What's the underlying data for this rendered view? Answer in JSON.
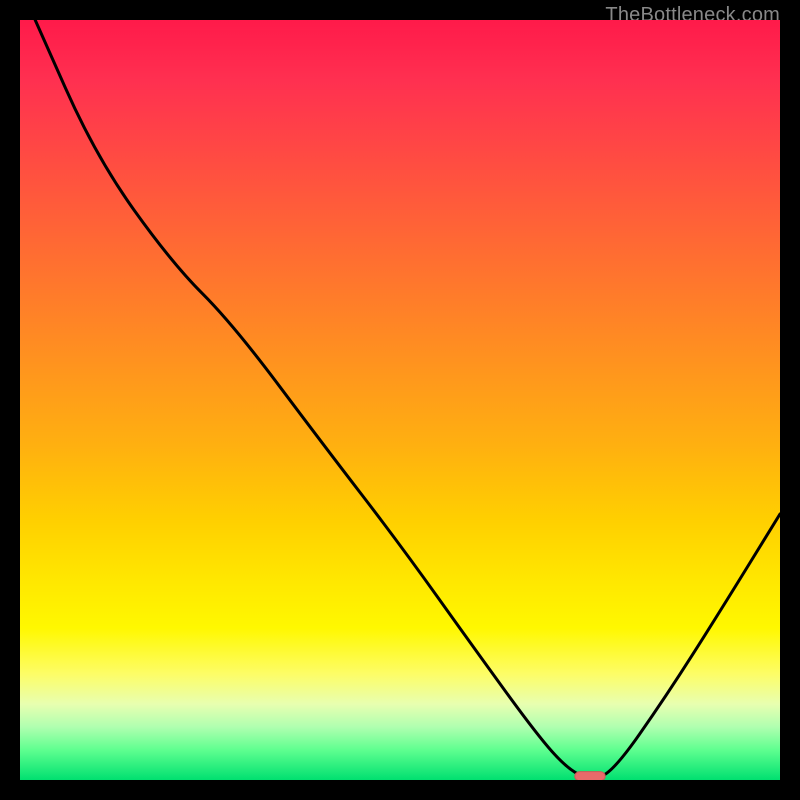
{
  "watermark": "TheBottleneck.com",
  "colors": {
    "background": "#000000",
    "curve": "#000000",
    "marker_fill": "#e86a6a",
    "marker_stroke": "#d05858"
  },
  "chart_data": {
    "type": "line",
    "title": "",
    "xlabel": "",
    "ylabel": "",
    "xlim": [
      0,
      100
    ],
    "ylim": [
      0,
      100
    ],
    "x": [
      2,
      10,
      20,
      28,
      40,
      50,
      60,
      68,
      72,
      75,
      78,
      85,
      92,
      100
    ],
    "values": [
      100,
      82,
      68,
      60,
      44,
      31,
      17,
      6,
      1.5,
      0,
      1,
      11,
      22,
      35
    ],
    "marker": {
      "x": 75,
      "y": 0.5,
      "width": 4,
      "height": 1.2
    }
  }
}
